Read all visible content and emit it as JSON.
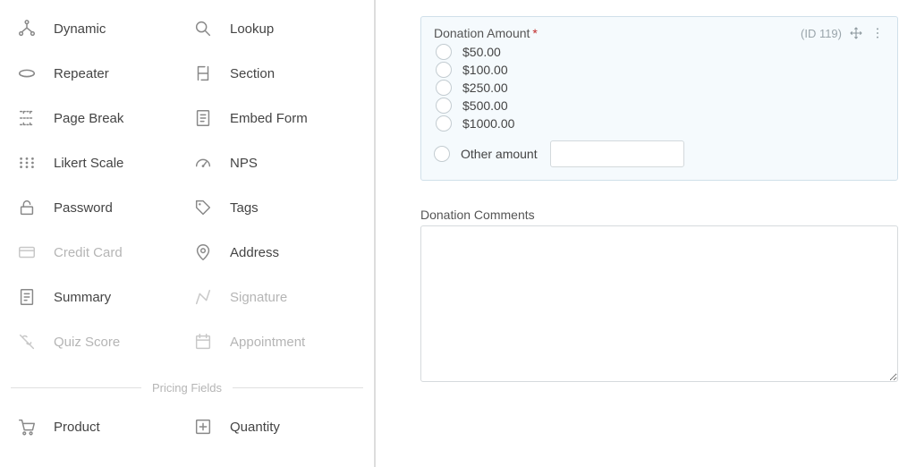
{
  "sidebar": {
    "fields": [
      {
        "icon": "dynamic",
        "label": "Dynamic",
        "disabled": false
      },
      {
        "icon": "lookup",
        "label": "Lookup",
        "disabled": false
      },
      {
        "icon": "repeater",
        "label": "Repeater",
        "disabled": false
      },
      {
        "icon": "section",
        "label": "Section",
        "disabled": false
      },
      {
        "icon": "pagebreak",
        "label": "Page Break",
        "disabled": false
      },
      {
        "icon": "embed",
        "label": "Embed Form",
        "disabled": false
      },
      {
        "icon": "likert",
        "label": "Likert Scale",
        "disabled": false
      },
      {
        "icon": "nps",
        "label": "NPS",
        "disabled": false
      },
      {
        "icon": "password",
        "label": "Password",
        "disabled": false
      },
      {
        "icon": "tags",
        "label": "Tags",
        "disabled": false
      },
      {
        "icon": "creditcard",
        "label": "Credit Card",
        "disabled": true
      },
      {
        "icon": "address",
        "label": "Address",
        "disabled": false
      },
      {
        "icon": "summary",
        "label": "Summary",
        "disabled": false
      },
      {
        "icon": "signature",
        "label": "Signature",
        "disabled": true
      },
      {
        "icon": "quizscore",
        "label": "Quiz Score",
        "disabled": true
      },
      {
        "icon": "appointment",
        "label": "Appointment",
        "disabled": true
      }
    ],
    "section_title": "Pricing Fields",
    "pricing_fields": [
      {
        "icon": "product",
        "label": "Product",
        "disabled": false
      },
      {
        "icon": "quantity",
        "label": "Quantity",
        "disabled": false
      }
    ]
  },
  "canvas": {
    "donation_field": {
      "label": "Donation Amount",
      "required": true,
      "id_text": "(ID 119)",
      "options": [
        "$50.00",
        "$100.00",
        "$250.00",
        "$500.00",
        "$1000.00"
      ],
      "other_label": "Other amount"
    },
    "comments_field": {
      "label": "Donation Comments"
    }
  }
}
